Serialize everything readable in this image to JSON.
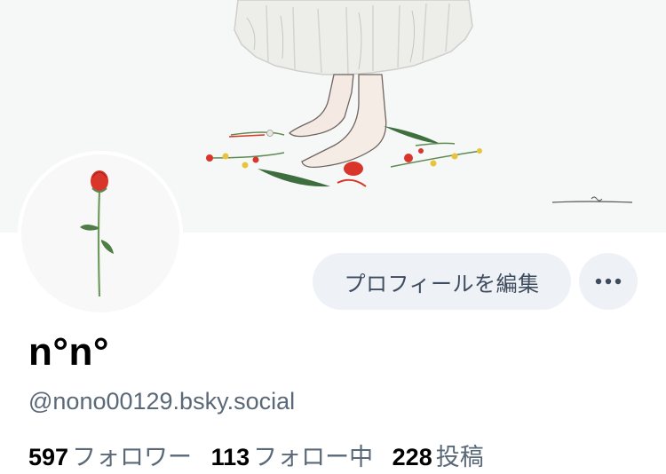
{
  "profile": {
    "display_name": "n°n°",
    "handle": "@nono00129.bsky.social"
  },
  "actions": {
    "edit_label": "プロフィールを編集",
    "more_icon": "more-horizontal-icon"
  },
  "stats": {
    "followers_count": "597",
    "followers_label": "フォロワー",
    "following_count": "113",
    "following_label": "フォロー中",
    "posts_count": "228",
    "posts_label": "投稿"
  },
  "colors": {
    "accent_button_bg": "#eef1f6",
    "muted_text": "#5a6878",
    "banner_bg": "#f6f8f7",
    "rose_red": "#d9352a"
  }
}
